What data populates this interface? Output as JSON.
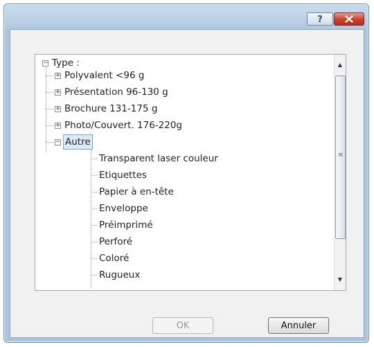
{
  "titlebar": {
    "help_label": "?",
    "close_icon": "close-icon",
    "close_color": "#c8402d"
  },
  "tree": {
    "root": {
      "label": "Type :",
      "expander": "−"
    },
    "categories": [
      {
        "label": "Polyvalent <96 g",
        "expander": "+"
      },
      {
        "label": "Présentation 96-130 g",
        "expander": "+"
      },
      {
        "label": "Brochure 131-175 g",
        "expander": "+"
      },
      {
        "label": "Photo/Couvert. 176-220g",
        "expander": "+"
      }
    ],
    "selected": {
      "label": "Autre",
      "expander": "−"
    },
    "children": [
      "Transparent laser couleur",
      "Etiquettes",
      "Papier à en-tête",
      "Enveloppe",
      "Préimprimé",
      "Perforé",
      "Coloré",
      "Rugueux"
    ]
  },
  "buttons": {
    "ok": "OK",
    "cancel": "Annuler"
  }
}
